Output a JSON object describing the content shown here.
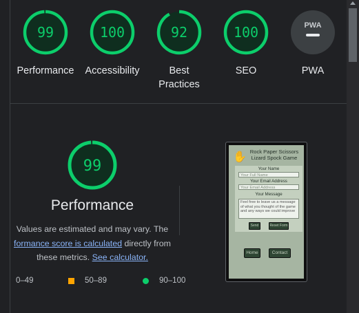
{
  "categories": [
    {
      "id": "performance",
      "score": "99",
      "label": "Performance",
      "fraction": 0.99
    },
    {
      "id": "accessibility",
      "score": "100",
      "label": "Accessibility",
      "fraction": 1.0
    },
    {
      "id": "best-practices",
      "score": "92",
      "label": "Best Practices",
      "fraction": 0.92
    },
    {
      "id": "seo",
      "score": "100",
      "label": "SEO",
      "fraction": 1.0
    },
    {
      "id": "pwa",
      "score": "",
      "label": "PWA",
      "fraction": null
    }
  ],
  "pwa_badge": "PWA",
  "detail": {
    "score": "99",
    "fraction": 0.99,
    "title": "Performance",
    "note_prefix": "Values are estimated and may vary. The ",
    "link1": "formance score is calculated",
    "note_mid": " directly from these metrics. ",
    "link2": "See calculator."
  },
  "legend": {
    "fail": "0–49",
    "average": "50–89",
    "pass": "90–100"
  },
  "preview": {
    "title": "Rock Paper Scissors Lizard Spock Game",
    "name_label": "Your Name",
    "name_placeholder": "Your Full Name",
    "email_label": "Your Email Address",
    "email_placeholder": "Your Email Address",
    "message_label": "Your Message",
    "message_text": "Feel free to leave us a message of what you thought of the game and any ways we could improve",
    "send": "Send",
    "reset": "Reset Form",
    "home": "Home",
    "contact": "Contact"
  },
  "colors": {
    "pass": "#0cce6b",
    "pass_bg": "#0f2e1f",
    "background": "#202124"
  }
}
